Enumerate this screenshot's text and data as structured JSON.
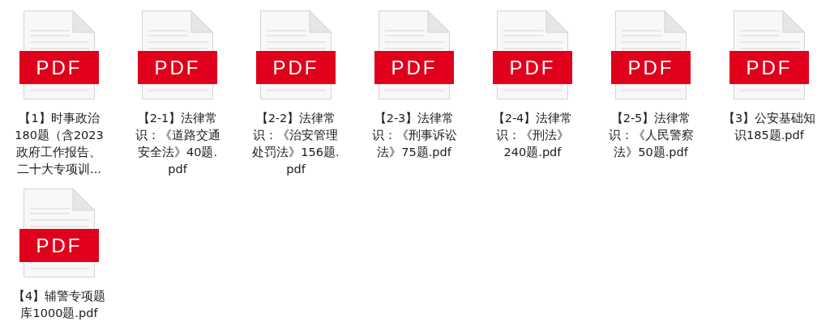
{
  "files": [
    {
      "badge": "PDF",
      "name_lines": [
        "【1】时事政治",
        "180题（含2023",
        "政府工作报告、",
        "二十大专项训..."
      ]
    },
    {
      "badge": "PDF",
      "name_lines": [
        "【2-1】法律常",
        "识：《道路交通",
        "安全法》40题.",
        "pdf"
      ]
    },
    {
      "badge": "PDF",
      "name_lines": [
        "【2-2】法律常",
        "识：《治安管理",
        "处罚法》156题.",
        "pdf"
      ]
    },
    {
      "badge": "PDF",
      "name_lines": [
        "【2-3】法律常",
        "识：《刑事诉讼",
        "法》75题.pdf"
      ]
    },
    {
      "badge": "PDF",
      "name_lines": [
        "【2-4】法律常",
        "识：《刑法》",
        "240题.pdf"
      ]
    },
    {
      "badge": "PDF",
      "name_lines": [
        "【2-5】法律常",
        "识：《人民警察",
        "法》50题.pdf"
      ]
    },
    {
      "badge": "PDF",
      "name_lines": [
        "【3】公安基础知",
        "识185题.pdf"
      ]
    },
    {
      "badge": "PDF",
      "name_lines": [
        "【4】辅警专项题",
        "库1000题.pdf"
      ]
    }
  ]
}
